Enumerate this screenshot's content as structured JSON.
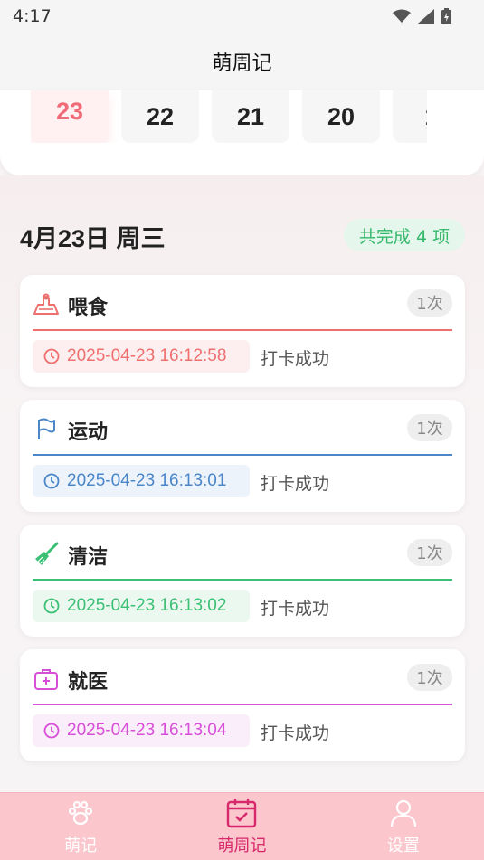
{
  "status_bar": {
    "time": "4:17"
  },
  "header": {
    "title": "萌周记"
  },
  "date_strip": {
    "dates": [
      "23",
      "22",
      "21",
      "20",
      "1"
    ],
    "selected": "23"
  },
  "day": {
    "title": "4月23日 周三",
    "done_badge": "共完成 4 项"
  },
  "records": [
    {
      "title": "喂食",
      "count": "1次",
      "time": "2025-04-23 16:12:58",
      "status": "打卡成功",
      "color": "#ef6f6f",
      "icon": "feeding-icon"
    },
    {
      "title": "运动",
      "count": "1次",
      "time": "2025-04-23 16:13:01",
      "status": "打卡成功",
      "color": "#4a86c8",
      "icon": "flag-icon"
    },
    {
      "title": "清洁",
      "count": "1次",
      "time": "2025-04-23 16:13:02",
      "status": "打卡成功",
      "color": "#3bbf74",
      "icon": "broom-icon"
    },
    {
      "title": "就医",
      "count": "1次",
      "time": "2025-04-23 16:13:04",
      "status": "打卡成功",
      "color": "#d64fd6",
      "icon": "medical-kit-icon"
    }
  ],
  "bottom_nav": [
    {
      "label": "萌记",
      "icon": "paw-icon",
      "active": false
    },
    {
      "label": "萌周记",
      "icon": "calendar-icon",
      "active": true
    },
    {
      "label": "设置",
      "icon": "user-icon",
      "active": false
    }
  ]
}
